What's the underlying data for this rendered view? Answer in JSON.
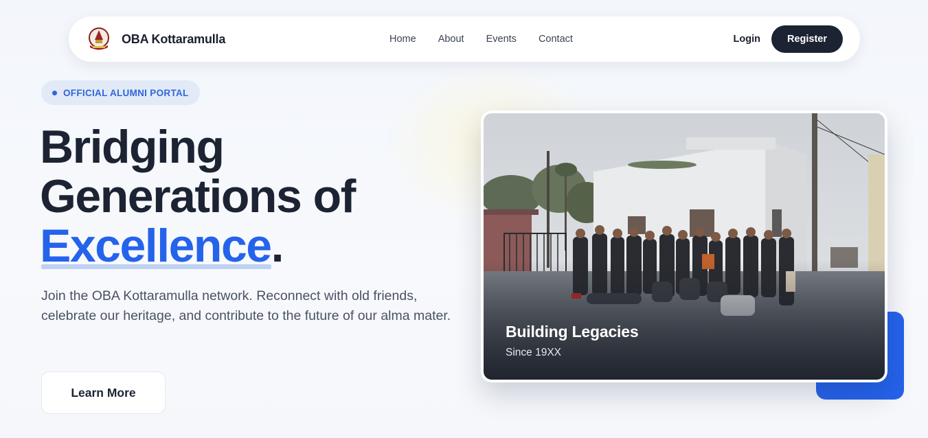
{
  "nav": {
    "brand": "OBA Kottaramulla",
    "links": [
      "Home",
      "About",
      "Events",
      "Contact"
    ],
    "login": "Login",
    "register": "Register"
  },
  "hero": {
    "badge": "OFFICIAL ALUMNI PORTAL",
    "headline_line1": "Bridging",
    "headline_line2": "Generations of",
    "headline_accent": "Excellence",
    "headline_period": ".",
    "description": "Join the OBA Kottaramulla network. Reconnect with old friends, celebrate our heritage, and contribute to the future of our alma mater.",
    "cta": "Learn More"
  },
  "photo": {
    "caption_title": "Building Legacies",
    "caption_subtitle": "Since 19XX"
  },
  "colors": {
    "accent": "#2563eb",
    "dark": "#1c2333",
    "badge_bg": "#e2eaf8"
  }
}
